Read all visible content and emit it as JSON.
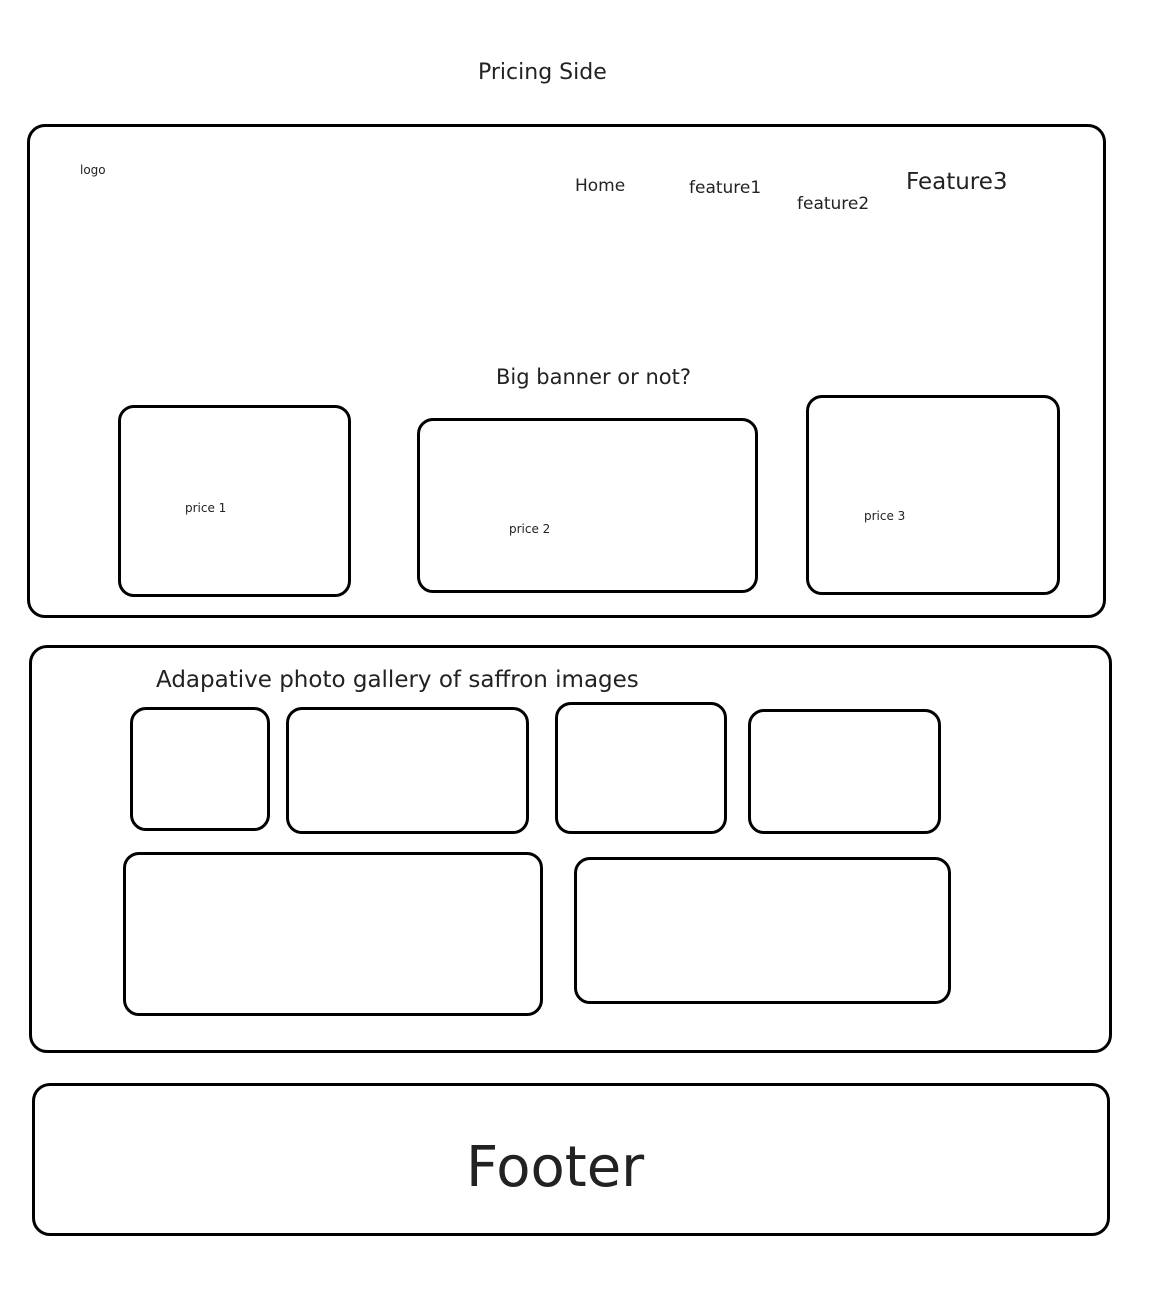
{
  "page_title": "Pricing Side",
  "header": {
    "logo_label": "logo",
    "nav": {
      "home": "Home",
      "feature1": "feature1",
      "feature2": "feature2",
      "feature3": "Feature3"
    },
    "banner_text": "Big banner or not?",
    "prices": [
      "price 1",
      "price 2",
      "price 3"
    ]
  },
  "gallery": {
    "title": "Adapative photo gallery of saffron images"
  },
  "footer": {
    "label": "Footer"
  }
}
